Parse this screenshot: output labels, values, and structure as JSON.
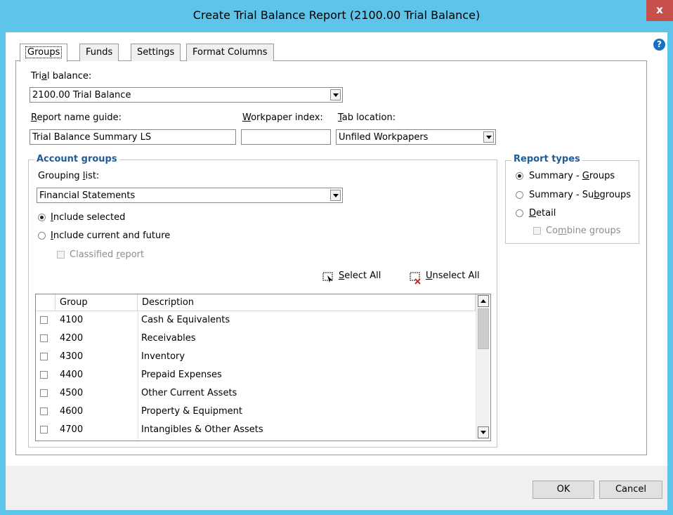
{
  "window": {
    "title": "Create Trial Balance Report (2100.00 Trial Balance)",
    "close_glyph": "x",
    "help_glyph": "?"
  },
  "tabs": [
    {
      "label": "Groups",
      "active": true
    },
    {
      "label": "Funds",
      "active": false
    },
    {
      "label": "Settings",
      "active": false
    },
    {
      "label": "Format Columns",
      "active": false
    }
  ],
  "trial_balance": {
    "label_pre": "Tri",
    "label_accel": "a",
    "label_post": "l balance:",
    "value": "2100.00 Trial Balance"
  },
  "report_name": {
    "label_pre": "",
    "label_accel": "R",
    "label_post": "eport name guide:",
    "value": "Trial Balance Summary LS"
  },
  "workpaper_index": {
    "label_pre": "",
    "label_accel": "W",
    "label_post": "orkpaper index:",
    "value": ""
  },
  "tab_location": {
    "label_pre": "",
    "label_accel": "T",
    "label_post": "ab location:",
    "value": "Unfiled Workpapers"
  },
  "account_groups": {
    "title": "Account groups",
    "grouping_label_pre": "Grouping ",
    "grouping_label_accel": "l",
    "grouping_label_post": "ist:",
    "grouping_value": "Financial Statements",
    "include_selected_pre": "",
    "include_selected_accel": "I",
    "include_selected_post": "nclude selected",
    "include_future_pre": "",
    "include_future_accel": "I",
    "include_future_post": "nclude current and future",
    "classified_pre": "Classified ",
    "classified_accel": "r",
    "classified_post": "eport",
    "select_all_pre": "",
    "select_all_accel": "S",
    "select_all_post": "elect All",
    "unselect_all_pre": "",
    "unselect_all_accel": "U",
    "unselect_all_post": "nselect All",
    "selection_mode": "Include selected"
  },
  "grid": {
    "columns": [
      "Group",
      "Description"
    ],
    "rows": [
      {
        "group": "4100",
        "description": "Cash & Equivalents",
        "checked": false
      },
      {
        "group": "4200",
        "description": "Receivables",
        "checked": false
      },
      {
        "group": "4300",
        "description": "Inventory",
        "checked": false
      },
      {
        "group": "4400",
        "description": "Prepaid Expenses",
        "checked": false
      },
      {
        "group": "4500",
        "description": "Other Current Assets",
        "checked": false
      },
      {
        "group": "4600",
        "description": "Property & Equipment",
        "checked": false
      },
      {
        "group": "4700",
        "description": "Intangibles & Other Assets",
        "checked": false
      }
    ]
  },
  "report_types": {
    "title": "Report types",
    "options": [
      {
        "pre": "Summary - ",
        "accel": "G",
        "post": "roups",
        "selected": true
      },
      {
        "pre": "Summary - Su",
        "accel": "b",
        "post": "groups",
        "selected": false
      },
      {
        "pre": "",
        "accel": "D",
        "post": "etail",
        "selected": false
      }
    ],
    "combine_pre": "Co",
    "combine_accel": "m",
    "combine_post": "bine groups"
  },
  "buttons": {
    "ok": "OK",
    "cancel": "Cancel"
  },
  "colors": {
    "titlebar": "#5dc4ea",
    "close": "#c7504b",
    "group_title": "#1e5b9a"
  }
}
